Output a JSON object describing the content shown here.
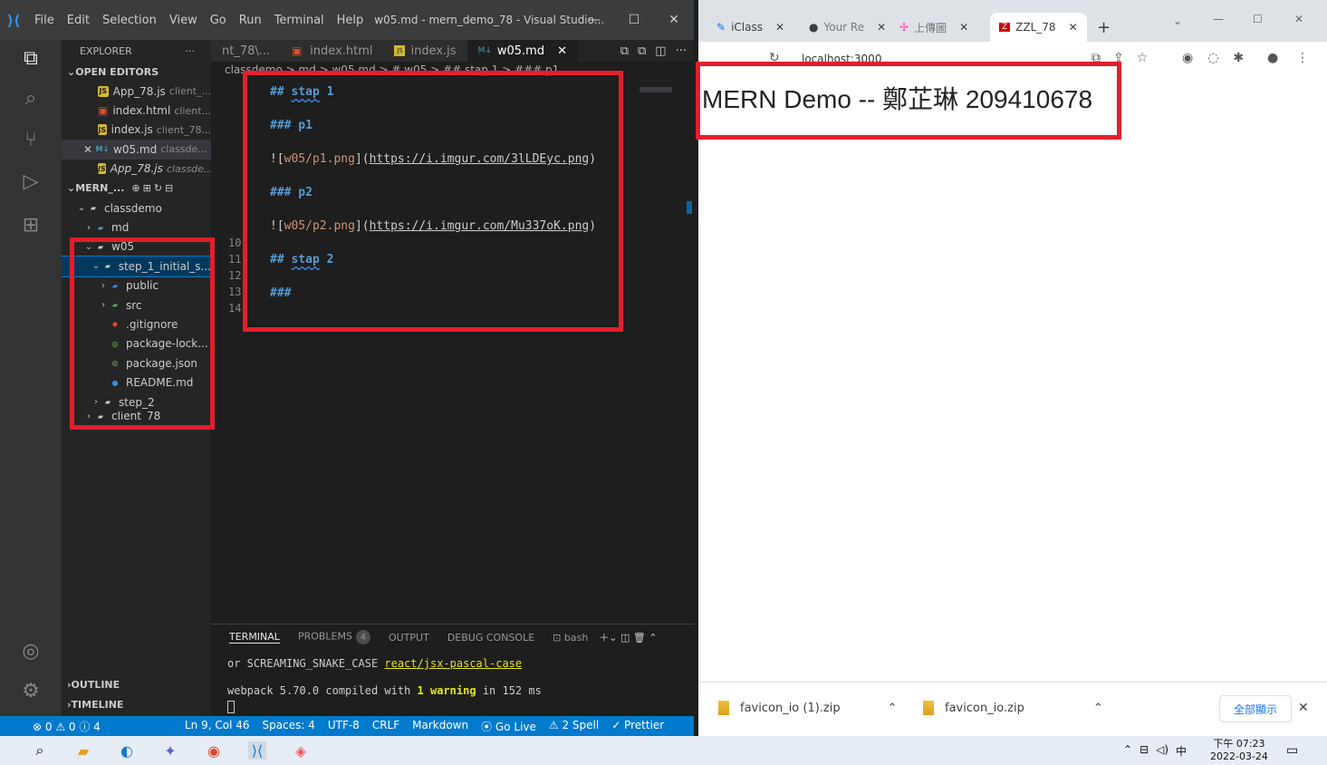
{
  "vscode": {
    "menu": [
      "File",
      "Edit",
      "Selection",
      "View",
      "Go",
      "Run",
      "Terminal",
      "Help"
    ],
    "window_title": "w05.md - mern_demo_78 - Visual Studio...",
    "explorer_label": "EXPLORER",
    "open_editors_label": "OPEN EDITORS",
    "open_editors": [
      {
        "name": "App_78.js",
        "path": "client_..."
      },
      {
        "name": "index.html",
        "path": "client..."
      },
      {
        "name": "index.js",
        "path": "client_78..."
      },
      {
        "name": "w05.md",
        "path": "classde..."
      },
      {
        "name": "App_78.js",
        "path": "classde..."
      }
    ],
    "workspace_label": "MERN_...",
    "tree": [
      {
        "label": "classdemo"
      },
      {
        "label": "md"
      },
      {
        "label": "w05"
      },
      {
        "label": "step_1_initial_s..."
      },
      {
        "label": "public"
      },
      {
        "label": "src"
      },
      {
        "label": ".gitignore"
      },
      {
        "label": "package-lock..."
      },
      {
        "label": "package.json"
      },
      {
        "label": "README.md"
      },
      {
        "label": "step_2"
      },
      {
        "label": "client_78"
      }
    ],
    "outline_label": "OUTLINE",
    "timeline_label": "TIMELINE",
    "tabs": [
      "nt_78\\...",
      "index.html",
      "index.js",
      "w05.md"
    ],
    "breadcrumb": "classdemo > md > w05.md > # w05 > ## stap 1 > ### p1",
    "line_numbers": [
      "10",
      "11",
      "12",
      "13",
      "14"
    ],
    "editor_lines": {
      "h_stap1_hash": "##",
      "h_stap1_word": "stap",
      "h_stap1_num": "1",
      "h_p1": "### p1",
      "img1_alt": "w05/p1.png",
      "img1_url": "https://i.imgur.com/3lLDEyc.png",
      "h_p2": "### p2",
      "img2_alt": "w05/p2.png",
      "img2_url": "https://i.imgur.com/Mu337oK.png",
      "h_stap2_hash": "##",
      "h_stap2_word": "stap",
      "h_stap2_num": "2",
      "h_empty": "###"
    },
    "panel": {
      "tabs": [
        "TERMINAL",
        "PROBLEMS",
        "OUTPUT",
        "DEBUG CONSOLE"
      ],
      "problems_count": "4",
      "shell": "bash",
      "line1_prefix": "or SCREAMING_SNAKE_CASE",
      "line1_rule": "react/jsx-pascal-case",
      "line2_a": "webpack 5.70.0 compiled with",
      "line2_num": "1",
      "line2_warn": "warning",
      "line2_b": "in 152 ms"
    },
    "status": {
      "problems": "⊗ 0 ⚠ 0 ⓘ 4",
      "items": [
        "Ln 9, Col 46",
        "Spaces: 4",
        "UTF-8",
        "CRLF",
        "Markdown",
        "Go Live",
        "2 Spell",
        "Prettier"
      ]
    }
  },
  "chrome": {
    "tabs": [
      {
        "label": "iClass"
      },
      {
        "label": "Your Re"
      },
      {
        "label": "上傳圖"
      },
      {
        "label": "ZZL_78"
      }
    ],
    "address": "localhost:3000",
    "page_heading": "MERN Demo -- 鄭芷琳 209410678",
    "downloads": [
      "favicon_io (1).zip",
      "favicon_io.zip"
    ],
    "show_all": "全部顯示"
  },
  "taskbar": {
    "time": "下午 07:23",
    "date": "2022-03-24",
    "ime": "中"
  },
  "colors": {
    "highlight_box": "#e41e2b",
    "statusbar": "#007acc",
    "markdown_heading": "#569cd6"
  }
}
